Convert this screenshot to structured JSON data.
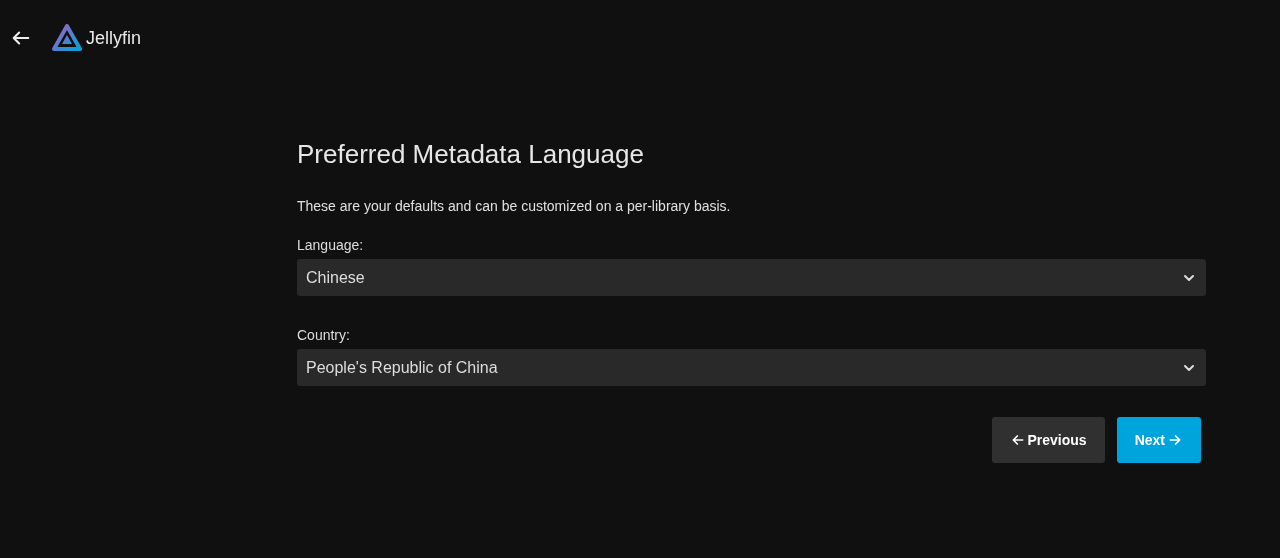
{
  "header": {
    "brand": "Jellyfin"
  },
  "title": "Preferred Metadata Language",
  "description": "These are your defaults and can be customized on a per-library basis.",
  "fields": [
    {
      "label": "Language:",
      "value": "Chinese"
    },
    {
      "label": "Country:",
      "value": "People's Republic of China"
    }
  ],
  "buttons": [
    {
      "kind": "previous",
      "label": "Previous"
    },
    {
      "kind": "next",
      "label": "Next"
    }
  ]
}
